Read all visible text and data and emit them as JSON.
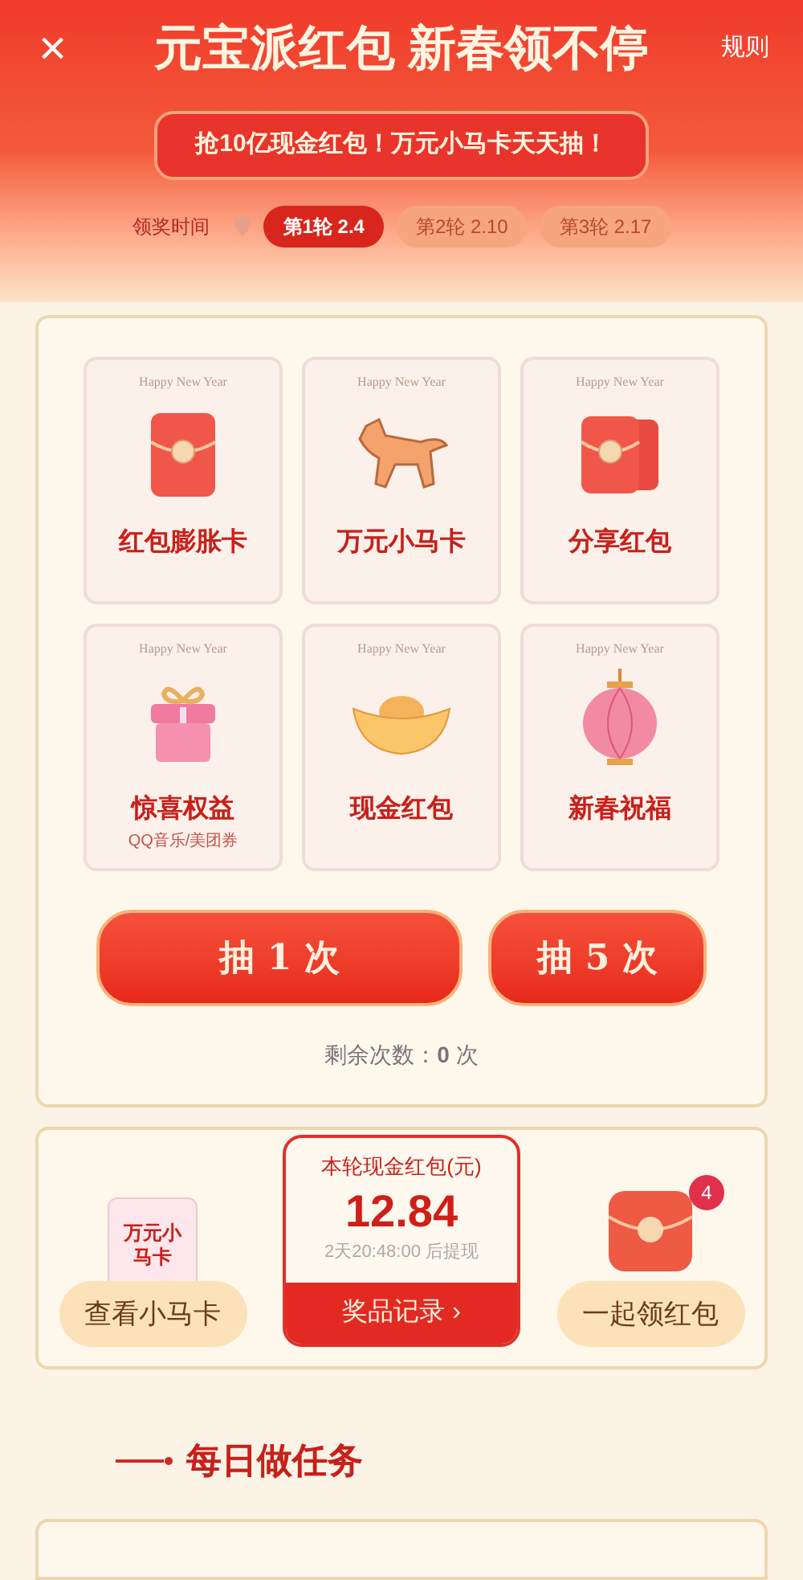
{
  "header": {
    "close": "×",
    "title": "元宝派红包 新春领不停",
    "rules": "规则",
    "banner": "抢**10亿**现金红包！万元小马卡天天抽！",
    "schedule_label": "领奖时间",
    "rounds": [
      {
        "label": "第1轮 2.4",
        "selected": true
      },
      {
        "label": "第2轮 2.10",
        "selected": false
      },
      {
        "label": "第3轮 2.17",
        "selected": false
      }
    ]
  },
  "cards": [
    {
      "kind": "envelope",
      "tag": "Happy New Year",
      "title": "红包膨胀卡"
    },
    {
      "kind": "horse",
      "tag": "Happy New Year",
      "title": "万元小马卡"
    },
    {
      "kind": "envelopes",
      "tag": "Happy New Year",
      "title": "分享红包"
    },
    {
      "kind": "gift",
      "tag": "Happy New Year",
      "title": "惊喜权益",
      "subtitle": "QQ音乐/美团券"
    },
    {
      "kind": "ingot",
      "tag": "Happy New Year",
      "title": "现金红包"
    },
    {
      "kind": "lantern",
      "tag": "Happy New Year",
      "title": "新春祝福"
    }
  ],
  "draw_buttons": [
    "抽 1 次",
    "抽 5 次"
  ],
  "remaining": "剩余次数：**0** 次",
  "bottom": {
    "left": {
      "card_text": "万元小马卡",
      "button": "查看小马卡"
    },
    "center": {
      "title": "本轮现金红包(元)",
      "amount": "12.84",
      "countdown": "2天20:48:00 后提现",
      "link": "奖品记录",
      "chevron": "›"
    },
    "right": {
      "badge": "4",
      "button": "一起领红包"
    }
  },
  "section_title": "每日做任务"
}
